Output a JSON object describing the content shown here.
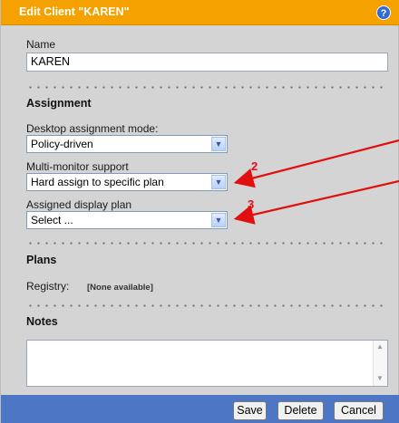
{
  "dialog": {
    "title": "Edit Client \"KAREN\"",
    "help_icon": "?"
  },
  "name": {
    "label": "Name",
    "value": "KAREN"
  },
  "assignment": {
    "heading": "Assignment",
    "desktop_mode_label": "Desktop assignment mode:",
    "desktop_mode_value": "Policy-driven",
    "multimonitor_label": "Multi-monitor support",
    "multimonitor_value": "Hard assign to specific plan",
    "display_plan_label": "Assigned display plan",
    "display_plan_value": "Select ..."
  },
  "plans": {
    "heading": "Plans",
    "registry_label": "Registry:",
    "registry_value": "[None available]"
  },
  "notes": {
    "heading": "Notes",
    "value": ""
  },
  "footer": {
    "save_label": "Save",
    "delete_label": "Delete",
    "cancel_label": "Cancel"
  },
  "annotations": {
    "marker_2": "2",
    "marker_3": "3",
    "color": "#e01010"
  },
  "colors": {
    "title_bar": "#f5a100",
    "footer": "#4d77c5",
    "panel": "#d4d4d4"
  }
}
